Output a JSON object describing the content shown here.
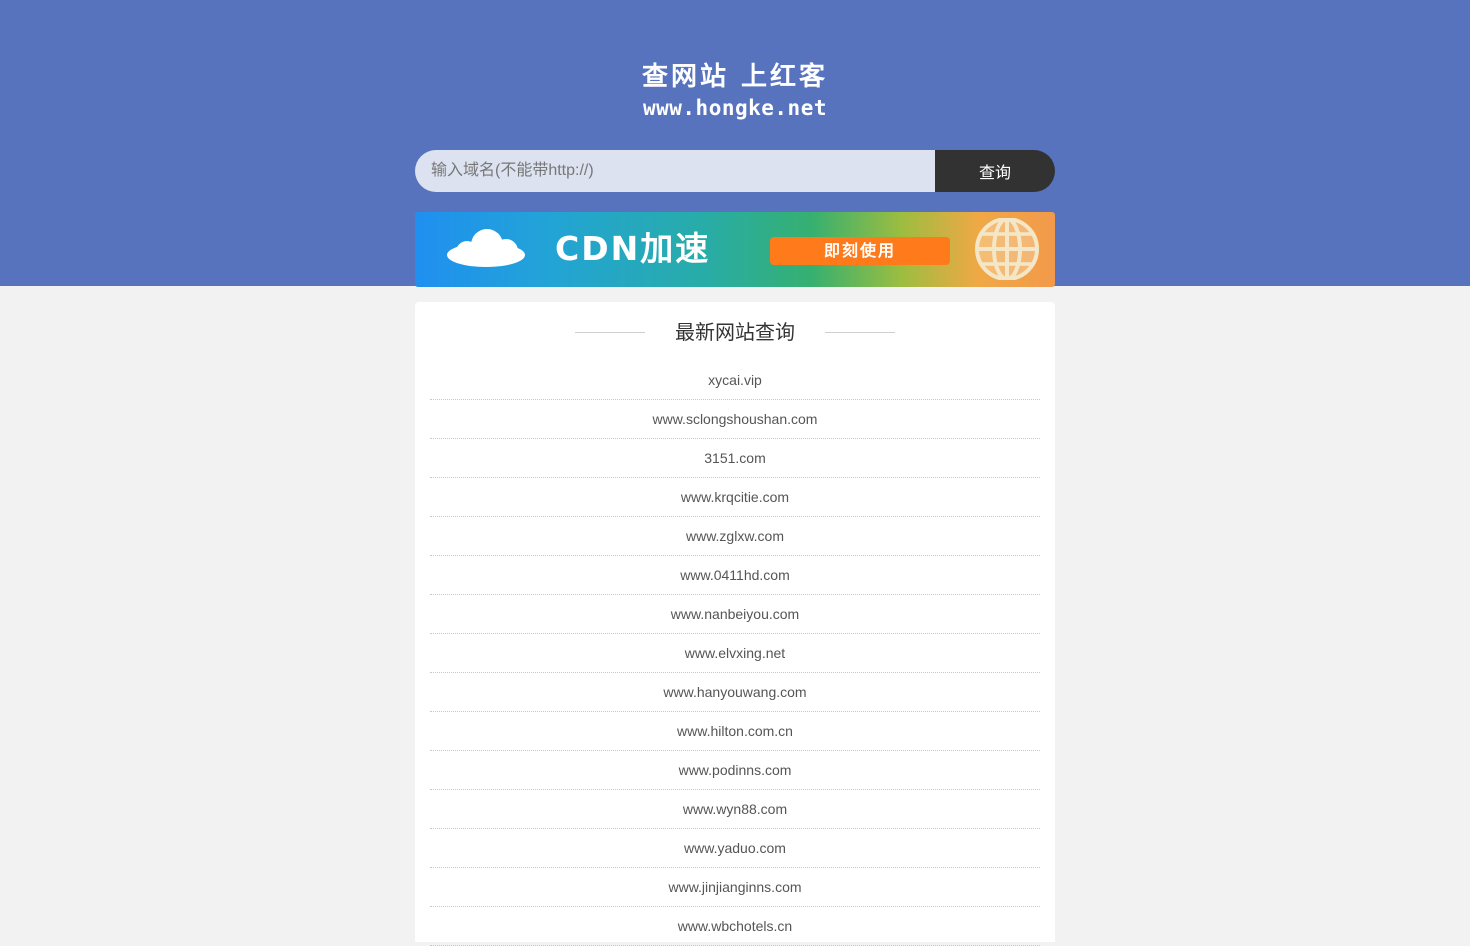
{
  "header": {
    "title": "查网站 上红客",
    "domain": "www.hongke.net"
  },
  "search": {
    "placeholder": "输入域名(不能带http://)",
    "button_label": "查询"
  },
  "banner": {
    "headline": "CDN加速",
    "cta": "即刻使用"
  },
  "recent": {
    "title": "最新网站查询",
    "items": [
      "xycai.vip",
      "www.sclongshoushan.com",
      "3151.com",
      "www.krqcitie.com",
      "www.zglxw.com",
      "www.0411hd.com",
      "www.nanbeiyou.com",
      "www.elvxing.net",
      "www.hanyouwang.com",
      "www.hilton.com.cn",
      "www.podinns.com",
      "www.wyn88.com",
      "www.yaduo.com",
      "www.jinjianginns.com",
      "www.wbchotels.cn"
    ]
  },
  "colors": {
    "header_bg": "#5873bd",
    "page_bg": "#f2f2f2",
    "search_button_bg": "#323232",
    "cta_bg": "#ff7a1a"
  }
}
